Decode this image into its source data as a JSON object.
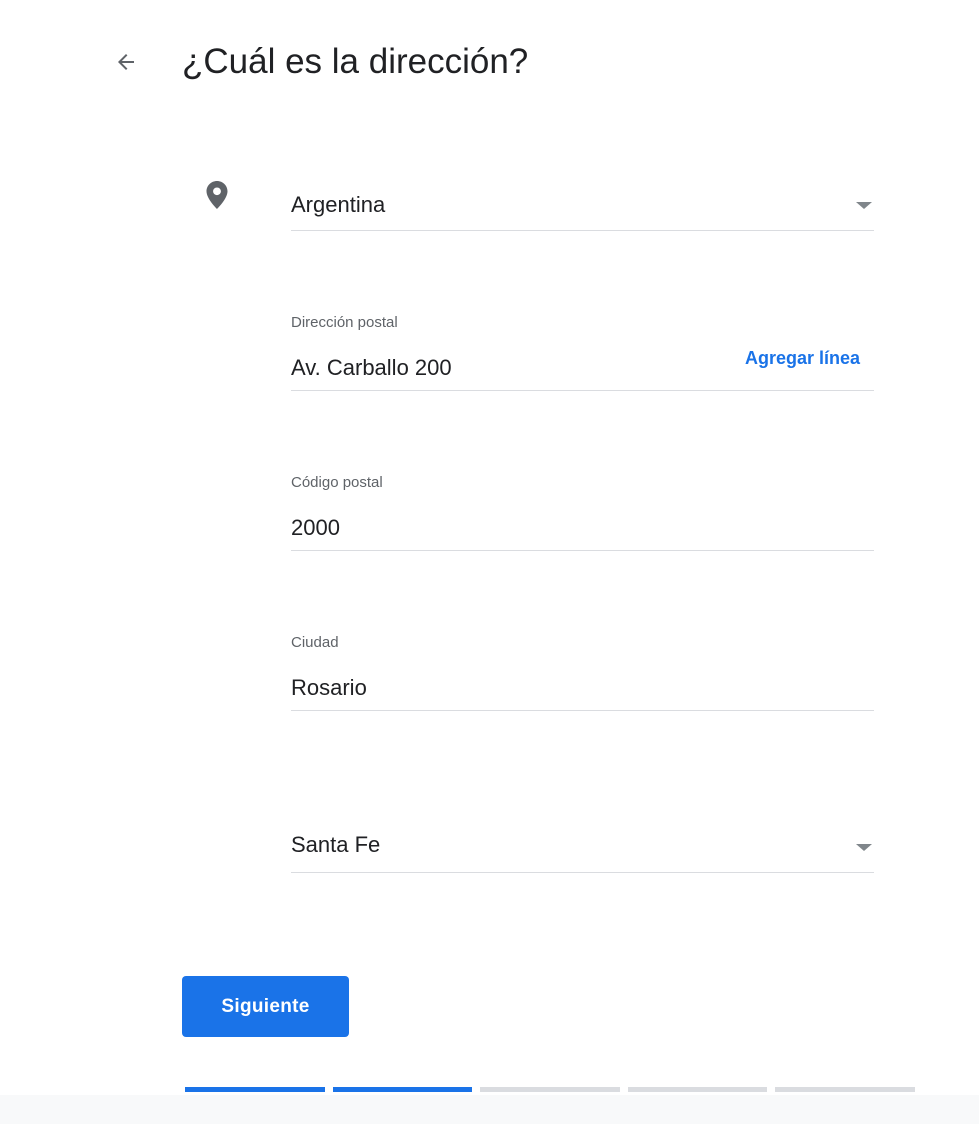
{
  "header": {
    "back_icon": "arrow-left-icon",
    "title": "¿Cuál es la dirección?"
  },
  "form": {
    "location_icon": "map-pin-icon",
    "country": {
      "value": "Argentina"
    },
    "street": {
      "label": "Dirección postal",
      "value": "Av. Carballo 200",
      "add_line_label": "Agregar línea"
    },
    "postal_code": {
      "label": "Código postal",
      "value": "2000"
    },
    "city": {
      "label": "Ciudad",
      "value": "Rosario"
    },
    "province": {
      "value": "Santa Fe"
    }
  },
  "actions": {
    "next_label": "Siguiente"
  },
  "progress": {
    "total_steps": 5,
    "completed_steps": 2,
    "active_color": "#1a73e8",
    "inactive_color": "#dadce0"
  },
  "colors": {
    "accent": "#1a73e8",
    "text_primary": "#202124",
    "text_secondary": "#5f6368",
    "divider": "#dadce0"
  }
}
